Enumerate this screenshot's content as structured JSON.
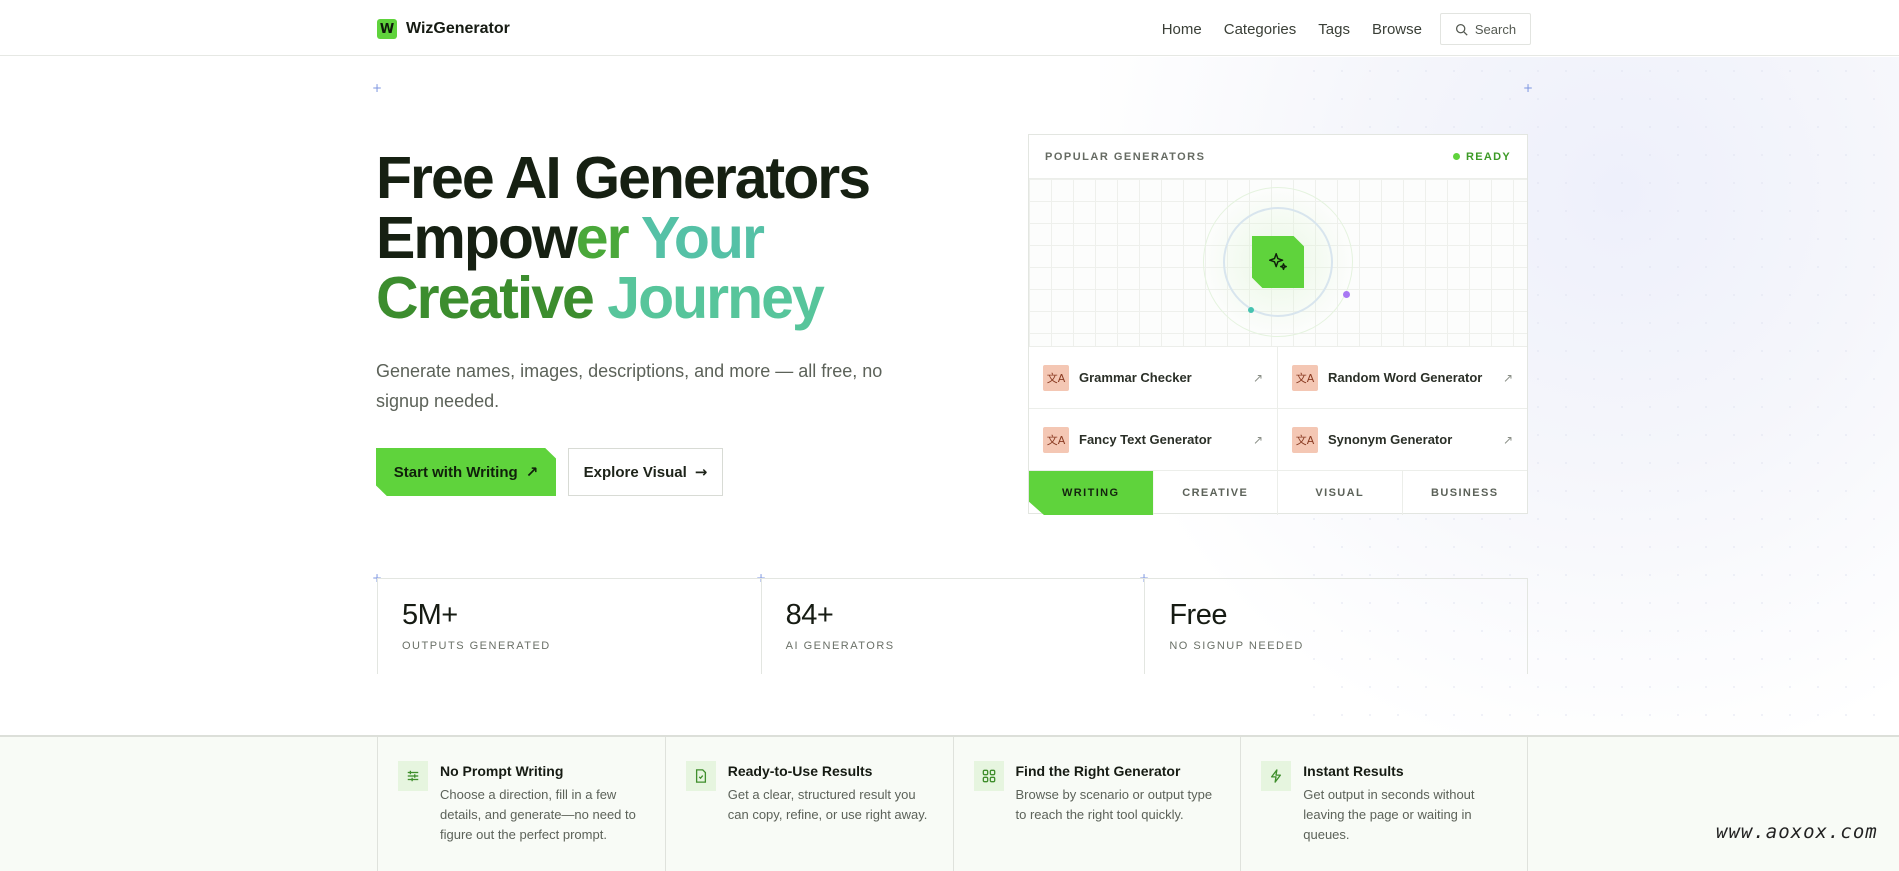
{
  "header": {
    "logo_letter": "W",
    "brand": "WizGenerator",
    "nav": [
      {
        "label": "Home"
      },
      {
        "label": "Categories"
      },
      {
        "label": "Tags"
      },
      {
        "label": "Browse"
      }
    ],
    "search_label": "Search",
    "search_icon": "search-icon"
  },
  "hero": {
    "title_line1": "Free AI Generators",
    "title_line2_a": "Empow",
    "title_line2_b": "er",
    "title_line2_c": " Your",
    "title_line3_a": "Creative",
    "title_line3_b": " Journey",
    "subtitle": "Generate names, images, descriptions, and more — all free, no signup needed.",
    "primary_button": "Start with Writing",
    "primary_arrow": "↗",
    "secondary_button": "Explore Visual",
    "secondary_arrow": "→"
  },
  "popular": {
    "title": "POPULAR GENERATORS",
    "status": "READY",
    "status_color": "#5fd33c",
    "center_icon": "sparkles-icon",
    "generators": [
      {
        "name": "Grammar Checker",
        "icon": "translate-icon"
      },
      {
        "name": "Random Word Generator",
        "icon": "translate-icon"
      },
      {
        "name": "Fancy Text Generator",
        "icon": "translate-icon"
      },
      {
        "name": "Synonym Generator",
        "icon": "translate-icon"
      }
    ],
    "tabs": [
      {
        "label": "WRITING",
        "active": true
      },
      {
        "label": "CREATIVE",
        "active": false
      },
      {
        "label": "VISUAL",
        "active": false
      },
      {
        "label": "BUSINESS",
        "active": false
      }
    ]
  },
  "stats": [
    {
      "value": "5M+",
      "label": "OUTPUTS GENERATED"
    },
    {
      "value": "84+",
      "label": "AI GENERATORS"
    },
    {
      "value": "Free",
      "label": "NO SIGNUP NEEDED"
    }
  ],
  "features": [
    {
      "title": "No Prompt Writing",
      "desc": "Choose a direction, fill in a few details, and generate—no need to figure out the perfect prompt.",
      "icon": "sliders-icon"
    },
    {
      "title": "Ready-to-Use Results",
      "desc": "Get a clear, structured result you can copy, refine, or use right away.",
      "icon": "file-icon"
    },
    {
      "title": "Find the Right Generator",
      "desc": "Browse by scenario or output type to reach the right tool quickly.",
      "icon": "grid-icon"
    },
    {
      "title": "Instant Results",
      "desc": "Get output in seconds without leaving the page or waiting in queues.",
      "icon": "bolt-icon"
    }
  ],
  "colors": {
    "accent": "#5fd33c",
    "dark": "#162012"
  },
  "watermark": "www.aoxox.com"
}
